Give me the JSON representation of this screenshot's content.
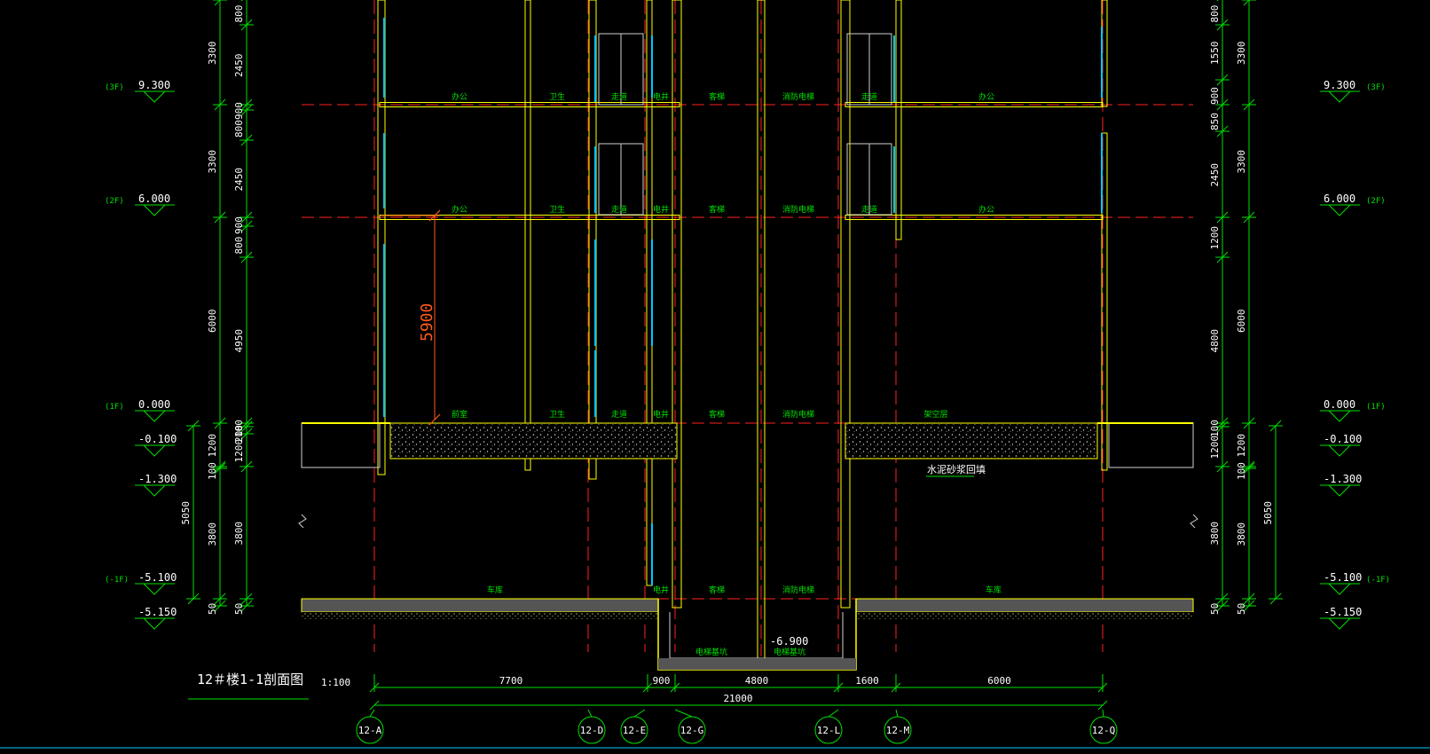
{
  "drawing": {
    "title": "12＃楼1-1剖面图",
    "scale": "1:100",
    "highlight_dimension": "5900",
    "colors": {
      "background": "#000000",
      "dim": "#00e000",
      "axis": "#ff2020",
      "wall": "#ffff00",
      "glass": "#00c8ff",
      "highlight": "#ff5a1e",
      "white": "#ffffff"
    }
  },
  "levels_left": [
    {
      "elev": "9.300",
      "tag": "(3F)"
    },
    {
      "elev": "6.000",
      "tag": "(2F)"
    },
    {
      "elev": "0.000",
      "tag": "(1F)"
    },
    {
      "elev": "-0.100",
      "tag": ""
    },
    {
      "elev": "-1.300",
      "tag": ""
    },
    {
      "elev": "-5.100",
      "tag": "(-1F)"
    },
    {
      "elev": "-5.150",
      "tag": ""
    }
  ],
  "levels_right": [
    {
      "elev": "9.300",
      "tag": "(3F)"
    },
    {
      "elev": "6.000",
      "tag": "(2F)"
    },
    {
      "elev": "0.000",
      "tag": "(1F)"
    },
    {
      "elev": "-0.100",
      "tag": ""
    },
    {
      "elev": "-1.300",
      "tag": ""
    },
    {
      "elev": "-5.100",
      "tag": "(-1F)"
    },
    {
      "elev": "-5.150",
      "tag": ""
    }
  ],
  "dims_left_outer": [
    "5050"
  ],
  "dims_left_story": [
    "3300",
    "3300",
    "6000",
    "1200",
    "100",
    "3800",
    "50"
  ],
  "dims_left_detail": [
    "800",
    "2450",
    "900",
    "800",
    "2450",
    "900",
    "800",
    "4950",
    "100",
    "200",
    "1200",
    "3800",
    "50"
  ],
  "dims_right_outer": [
    "5050"
  ],
  "dims_right_story": [
    "3300",
    "3300",
    "6000",
    "1200",
    "100",
    "3800",
    "50"
  ],
  "dims_right_detail": [
    "800",
    "1550",
    "900",
    "850",
    "2450",
    "1200",
    "4800",
    "100",
    "1200",
    "3800",
    "50"
  ],
  "room_labels": {
    "f3": [
      "办公",
      "卫生",
      "走道",
      "电井",
      "客梯",
      "消防电梯",
      "走道",
      "办公"
    ],
    "f2": [
      "办公",
      "卫生",
      "走道",
      "电井",
      "客梯",
      "消防电梯",
      "走道",
      "办公"
    ],
    "f1": [
      "前室",
      "卫生",
      "走道",
      "电井",
      "客梯",
      "消防电梯",
      "架空层"
    ],
    "b1": [
      "车库",
      "电井",
      "客梯",
      "消防电梯",
      "车库"
    ],
    "pit": [
      "电梯基坑",
      "电梯基坑"
    ]
  },
  "fill_note": "水泥砂浆回填",
  "pit_elev": "-6.900",
  "bay_dims": [
    "7700",
    "900",
    "4800",
    "1600",
    "6000"
  ],
  "total_dim": "21000",
  "axes": [
    "12-A",
    "12-D",
    "12-E",
    "12-G",
    "12-L",
    "12-M",
    "12-Q"
  ]
}
